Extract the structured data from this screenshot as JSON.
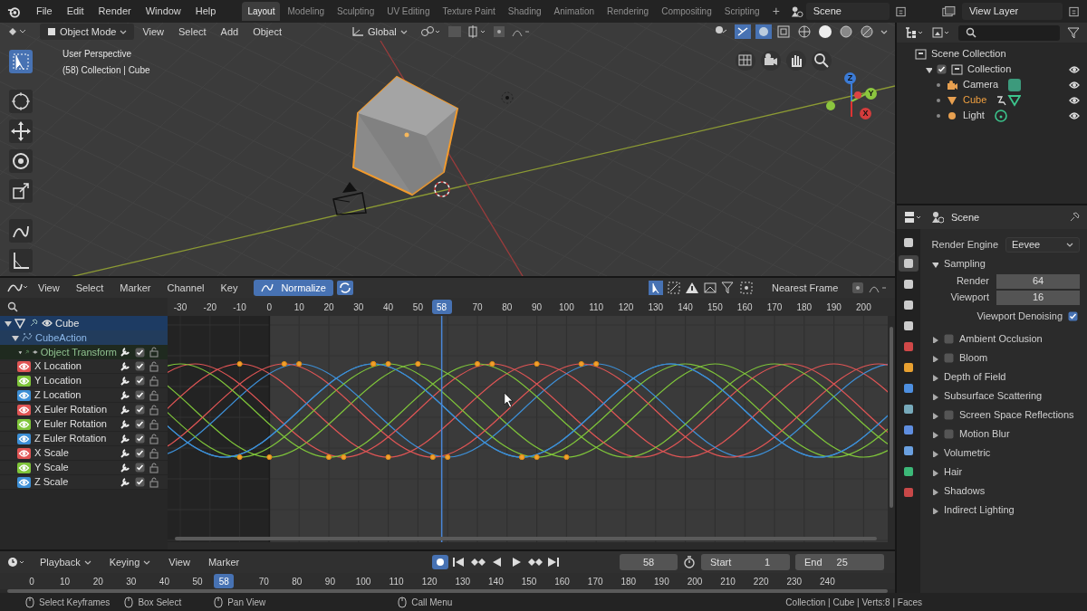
{
  "topbar": {
    "menus": [
      "File",
      "Edit",
      "Render",
      "Window",
      "Help"
    ],
    "workspaces": [
      {
        "label": "Layout",
        "selected": true
      },
      {
        "label": "Modeling",
        "selected": false
      },
      {
        "label": "Sculpting",
        "selected": false
      },
      {
        "label": "UV Editing",
        "selected": false
      },
      {
        "label": "Texture Paint",
        "selected": false
      },
      {
        "label": "Shading",
        "selected": false
      },
      {
        "label": "Animation",
        "selected": false
      },
      {
        "label": "Rendering",
        "selected": false
      },
      {
        "label": "Compositing",
        "selected": false
      },
      {
        "label": "Scripting",
        "selected": false
      }
    ],
    "add_tab": "+",
    "scene": "Scene",
    "view_layer": "View Layer"
  },
  "viewport": {
    "mode": "Object Mode",
    "menus": [
      "View",
      "Select",
      "Add",
      "Object"
    ],
    "orientation": "Global",
    "title": "User Perspective",
    "subtitle": "(58) Collection | Cube",
    "tools": [
      {
        "selected": true
      },
      {
        "selected": false
      },
      {
        "selected": false
      },
      {
        "selected": false
      },
      {
        "selected": false
      },
      {
        "selected": false
      },
      {
        "selected": false
      }
    ],
    "axes": [
      "Z",
      "Y",
      "X"
    ]
  },
  "graph_editor": {
    "menus": [
      "View",
      "Select",
      "Marker",
      "Channel",
      "Key"
    ],
    "normalize": {
      "label": "Normalize",
      "on": true
    },
    "snap": "Nearest Frame",
    "ruler": [
      "-30",
      "-20",
      "-10",
      "0",
      "10",
      "20",
      "30",
      "40",
      "50",
      "70",
      "80",
      "90",
      "100",
      "110",
      "120",
      "130",
      "140",
      "150",
      "160",
      "170",
      "180",
      "190",
      "200"
    ],
    "current_frame": "58",
    "channels": [
      {
        "label": "Cube",
        "selected": true,
        "children": [
          {
            "label": "CubeAction",
            "selected": true,
            "children": [
              {
                "label": "Object Transform",
                "selected": false,
                "children": [
                  {
                    "label": "X Location",
                    "color": "#e05555",
                    "checked": true
                  },
                  {
                    "label": "Y Location",
                    "color": "#7fc53a",
                    "checked": true
                  },
                  {
                    "label": "Z Location",
                    "color": "#3d8fd6",
                    "checked": true
                  },
                  {
                    "label": "X Euler Rotation",
                    "color": "#e05555",
                    "checked": true
                  },
                  {
                    "label": "Y Euler Rotation",
                    "color": "#7fc53a",
                    "checked": true
                  },
                  {
                    "label": "Z Euler Rotation",
                    "color": "#3d8fd6",
                    "checked": true
                  },
                  {
                    "label": "X Scale",
                    "color": "#e05555",
                    "checked": true
                  },
                  {
                    "label": "Y Scale",
                    "color": "#7fc53a",
                    "checked": true
                  },
                  {
                    "label": "Z Scale",
                    "color": "#3d8fd6",
                    "checked": true
                  }
                ]
              }
            ]
          }
        ]
      }
    ]
  },
  "timeline": {
    "menus": [
      "Playback",
      "Keying",
      "View",
      "Marker"
    ],
    "record": {
      "on": true
    },
    "frame": "58",
    "start_label": "Start",
    "start": "1",
    "end_label": "End",
    "end": "25",
    "ruler": [
      "0",
      "10",
      "20",
      "30",
      "40",
      "50",
      "70",
      "80",
      "90",
      "100",
      "110",
      "120",
      "130",
      "140",
      "150",
      "160",
      "170",
      "180",
      "190",
      "200",
      "210",
      "220",
      "230",
      "240"
    ],
    "current_frame": "58"
  },
  "outliner": {
    "tree": [
      {
        "label": "Scene Collection",
        "children": [
          {
            "label": "Collection",
            "checked": true,
            "children": [
              {
                "label": "Camera",
                "kind": "camera",
                "active": false
              },
              {
                "label": "Cube",
                "kind": "mesh",
                "active": true
              },
              {
                "label": "Light",
                "kind": "light",
                "active": false
              }
            ]
          }
        ]
      }
    ]
  },
  "properties": {
    "title": "Scene",
    "tabs": [
      {
        "selected": false
      },
      {
        "selected": true
      },
      {
        "selected": false
      },
      {
        "selected": false
      },
      {
        "selected": false
      },
      {
        "selected": false
      },
      {
        "selected": false
      },
      {
        "selected": false
      },
      {
        "selected": false
      },
      {
        "selected": false
      },
      {
        "selected": false
      },
      {
        "selected": false
      },
      {
        "selected": false
      }
    ],
    "render_engine": {
      "label": "Render Engine",
      "value": "Eevee"
    },
    "sections": [
      {
        "label": "Sampling",
        "kind": "plain",
        "expanded": true,
        "fields": [
          {
            "label": "Render",
            "value": "64"
          },
          {
            "label": "Viewport",
            "value": "16"
          }
        ],
        "toggle": {
          "label": "Viewport Denoising",
          "checked": true
        }
      },
      {
        "label": "Ambient Occlusion",
        "kind": "checkbox",
        "checked": false,
        "expanded": false
      },
      {
        "label": "Bloom",
        "kind": "checkbox",
        "checked": false,
        "expanded": false
      },
      {
        "label": "Depth of Field",
        "kind": "plain",
        "expanded": false
      },
      {
        "label": "Subsurface Scattering",
        "kind": "plain",
        "expanded": false
      },
      {
        "label": "Screen Space Reflections",
        "kind": "checkbox",
        "checked": false,
        "expanded": false
      },
      {
        "label": "Motion Blur",
        "kind": "checkbox",
        "checked": false,
        "expanded": false
      },
      {
        "label": "Volumetric",
        "kind": "plain",
        "expanded": false
      },
      {
        "label": "Hair",
        "kind": "plain",
        "expanded": false
      },
      {
        "label": "Shadows",
        "kind": "plain",
        "expanded": false
      },
      {
        "label": "Indirect Lighting",
        "kind": "plain",
        "expanded": false
      }
    ]
  },
  "status_bar": {
    "hints": [
      "Select Keyframes",
      "Box Select",
      "Pan View",
      "Call Menu"
    ],
    "stats": "Collection | Cube | Verts:8 | Faces"
  }
}
